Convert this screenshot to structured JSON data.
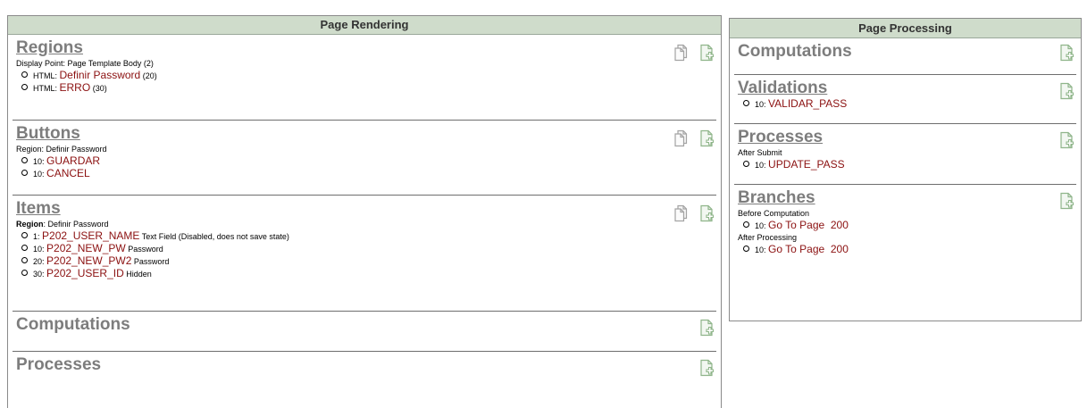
{
  "rendering": {
    "header": "Page Rendering",
    "regions": {
      "title": "Regions",
      "display_point": "Display Point: Page Template Body (2)",
      "items": [
        {
          "type": "HTML:",
          "name": "Definir Password",
          "seq": "(20)"
        },
        {
          "type": "HTML:",
          "name": "ERRO",
          "seq": "(30)"
        }
      ]
    },
    "buttons": {
      "title": "Buttons",
      "region": "Region: Definir Password",
      "items": [
        {
          "seq": "10:",
          "name": "GUARDAR"
        },
        {
          "seq": "10:",
          "name": "CANCEL"
        }
      ]
    },
    "items": {
      "title": "Items",
      "region_label": "Region",
      "region_value": ": Definir Password",
      "items": [
        {
          "seq": "1:",
          "name": "P202_USER_NAME",
          "desc": "Text Field (Disabled, does not save state)"
        },
        {
          "seq": "10:",
          "name": "P202_NEW_PW",
          "desc": "Password"
        },
        {
          "seq": "20:",
          "name": "P202_NEW_PW2",
          "desc": "Password"
        },
        {
          "seq": "30:",
          "name": "P202_USER_ID",
          "desc": "Hidden"
        }
      ]
    },
    "computations": {
      "title": "Computations"
    },
    "processes": {
      "title": "Processes"
    }
  },
  "processing": {
    "header": "Page Processing",
    "computations": {
      "title": "Computations"
    },
    "validations": {
      "title": "Validations",
      "items": [
        {
          "seq": "10:",
          "name": "VALIDAR_PASS"
        }
      ]
    },
    "processes": {
      "title": "Processes",
      "point": "After Submit",
      "items": [
        {
          "seq": "10:",
          "name": "UPDATE_PASS"
        }
      ]
    },
    "branches": {
      "title": "Branches",
      "before_label": "Before Computation",
      "before_item": {
        "seq": "10:",
        "name": "Go To Page  200"
      },
      "after_label": "After Processing",
      "after_item": {
        "seq": "10:",
        "name": "Go To Page  200"
      }
    }
  },
  "colors": {
    "header_bg": "#cfdccb",
    "link": "#8b1010",
    "section_title": "#7d7d7d",
    "icon_green": "#8fb58a"
  },
  "icons": {
    "copy": "copy-icon",
    "add": "add-icon"
  }
}
